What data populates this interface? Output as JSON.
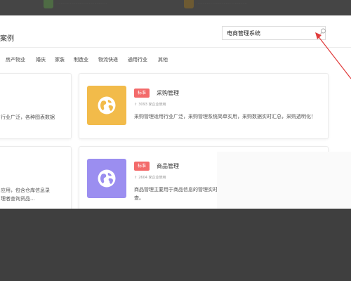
{
  "top_strip": {
    "items": [
      {
        "icon_color": "#4e6b44"
      },
      {
        "icon_color": "#6d5a32"
      }
    ]
  },
  "page": {
    "title_fragment": "案例"
  },
  "search": {
    "value": "电商管理系统",
    "icon": "search-icon"
  },
  "categories": [
    "房产物业",
    "婚庆",
    "家装",
    "制造业",
    "物流快递",
    "通用行业",
    "其他"
  ],
  "left_column_fragments": {
    "card1_line": "行业广泛，各种图表数据",
    "card2_line1": "应用，包含仓库信息录",
    "card2_line2": "理者查询货品..."
  },
  "cards": [
    {
      "badge": "标准",
      "name": "采购管理",
      "users": "3093 家企业使用",
      "description": "采购管理适用行业广泛，采购管理系统简单实用，采购数据实时汇总，采购透明化！",
      "icon": "globe-icon",
      "icon_bg": "#f2bb4a"
    },
    {
      "badge": "标准",
      "name": "商品管理",
      "users": "2604 家企业使用",
      "description": "商品管理主要用于商品信息的管理实时可查。",
      "icon": "globe-icon",
      "icon_bg": "#9b8ef0"
    }
  ],
  "colors": {
    "badge": "#f36b6b",
    "annotation_arrow": "#e03a3a"
  }
}
